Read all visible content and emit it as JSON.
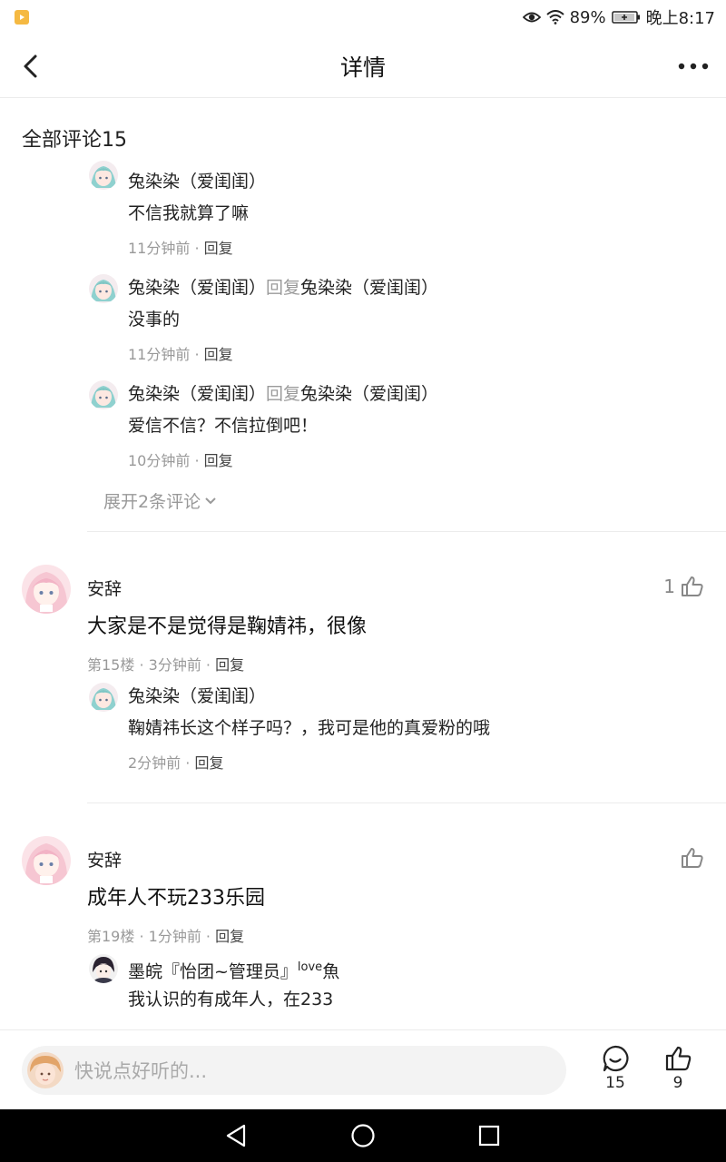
{
  "status_bar": {
    "battery": "89%",
    "time": "晚上8:17"
  },
  "header": {
    "title": "详情"
  },
  "section": {
    "title": "全部评论15"
  },
  "thread1": {
    "replies": [
      {
        "name": "兔染染（爱闺闺）",
        "reply_word": "",
        "reply_to": "",
        "text": "不信我就算了嘛",
        "time": "11分钟前",
        "reply": "回复"
      },
      {
        "name": "兔染染（爱闺闺）",
        "reply_word": "回复",
        "reply_to": "兔染染（爱闺闺）",
        "text": "没事的",
        "time": "11分钟前",
        "reply": "回复"
      },
      {
        "name": "兔染染（爱闺闺）",
        "reply_word": "回复",
        "reply_to": "兔染染（爱闺闺）",
        "text": "爱信不信？不信拉倒吧！",
        "time": "10分钟前",
        "reply": "回复"
      }
    ],
    "expand": "展开2条评论"
  },
  "comment2": {
    "name": "安辞",
    "text": "大家是不是觉得是鞠婧祎，很像",
    "floor": "第15楼",
    "time": "3分钟前",
    "reply": "回复",
    "likes": "1",
    "sub": {
      "name": "兔染染（爱闺闺）",
      "text": "鞠婧祎长这个样子吗？，我可是他的真爱粉的哦",
      "time": "2分钟前",
      "reply": "回复"
    }
  },
  "comment3": {
    "name": "安辞",
    "text": "成年人不玩233乐园",
    "floor": "第19楼",
    "time": "1分钟前",
    "reply": "回复",
    "likes": "",
    "sub": {
      "name_main": "墨皖『怡团~管理员』",
      "name_sup": "love",
      "name_tail": "魚",
      "text": "我认识的有成年人，在233"
    }
  },
  "bottom_bar": {
    "placeholder": "快说点好听的...",
    "comment_count": "15",
    "like_count": "9"
  },
  "colors": {
    "badge": "#f5b942",
    "divider": "#ececec",
    "gray_text": "#999999"
  }
}
